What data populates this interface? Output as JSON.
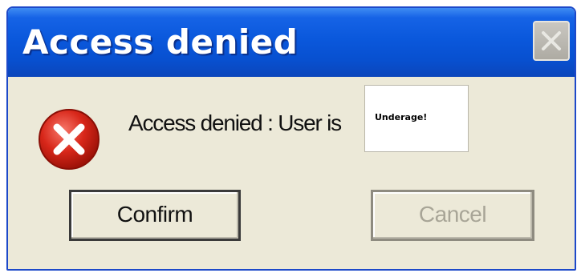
{
  "window": {
    "title": "Access denied",
    "close_icon": "close-icon"
  },
  "content": {
    "icon": "error-icon",
    "message": "Access denied : User is",
    "value": "Underage!"
  },
  "buttons": {
    "confirm_label": "Confirm",
    "cancel_label": "Cancel"
  },
  "colors": {
    "titlebar": "#0a58dc",
    "dialog_body": "#ece9d8",
    "error_red": "#d8271a"
  }
}
